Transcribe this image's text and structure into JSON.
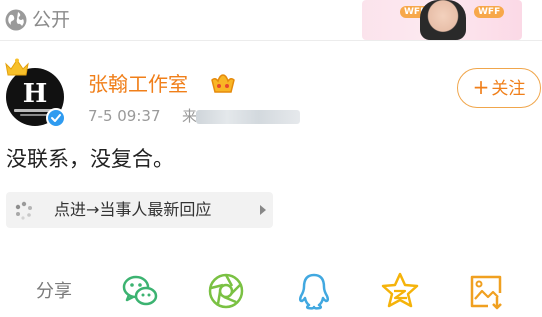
{
  "topbar": {
    "visibility_icon": "globe-icon",
    "visibility_label": "公开",
    "banner": {
      "tag_left": "WFF",
      "tag_right": "WFF"
    }
  },
  "post": {
    "author": {
      "name": "张翰工作室",
      "avatar_letter": "H",
      "badges": [
        "crown-icon",
        "vip-crown-icon",
        "verified-icon"
      ]
    },
    "time": "7-5 09:37",
    "source_prefix": "来",
    "follow_button": {
      "icon": "+",
      "label": "关注"
    },
    "text": "没联系，没复合。",
    "topic_card": {
      "icon": "dots-icon",
      "label": "点进→当事人最新回应"
    }
  },
  "share": {
    "label": "分享",
    "targets": [
      {
        "icon": "wechat-icon",
        "color": "#3cb371"
      },
      {
        "icon": "moments-icon",
        "color": "#7ac143"
      },
      {
        "icon": "qq-icon",
        "color": "#41a8e0"
      },
      {
        "icon": "qzone-icon",
        "color": "#f5b30a"
      },
      {
        "icon": "save-image-icon",
        "color": "#f0a020"
      }
    ]
  },
  "colors": {
    "accent": "#f07f1a",
    "username": "#f07f1a",
    "meta": "#9a9a9a",
    "verified": "#2f9bf0"
  }
}
